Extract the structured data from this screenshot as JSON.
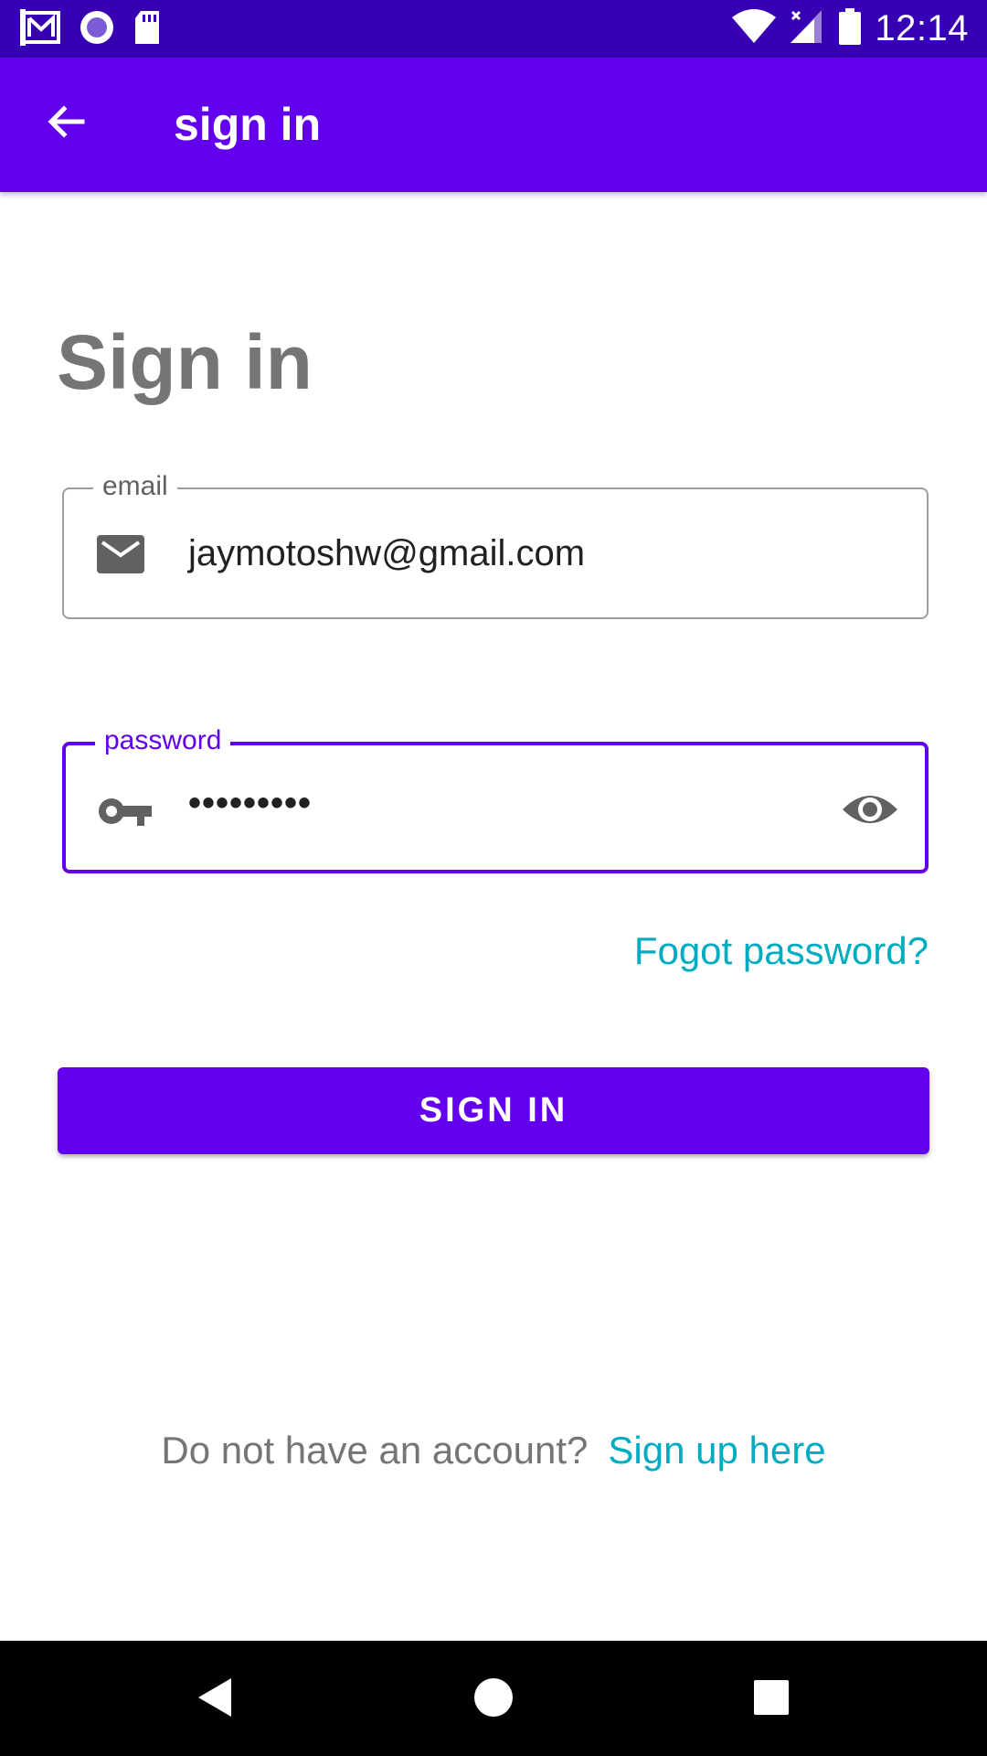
{
  "status_bar": {
    "time": "12:14",
    "icons": [
      "gmail-icon",
      "record-icon",
      "sd-card-icon",
      "wifi-icon",
      "signal-icon",
      "battery-icon"
    ]
  },
  "app_bar": {
    "title": "sign in",
    "back_icon": "arrow-back-icon",
    "color": "#6200ee"
  },
  "main": {
    "heading": "Sign in",
    "email": {
      "label": "email",
      "value": "jaymotoshw@gmail.com",
      "icon": "mail-icon"
    },
    "password": {
      "label": "password",
      "value": "•••••••••",
      "icon": "key-icon",
      "toggle_icon": "eye-icon"
    },
    "forgot_link": "Fogot password?",
    "signin_button": "SIGN IN",
    "signup_prompt": "Do not have an account?",
    "signup_link": "Sign up here"
  },
  "colors": {
    "primary": "#6200ee",
    "primary_dark": "#3700b3",
    "link": "#00acc1"
  },
  "nav_bar": {
    "icons": [
      "nav-back-icon",
      "nav-home-icon",
      "nav-recents-icon"
    ]
  }
}
